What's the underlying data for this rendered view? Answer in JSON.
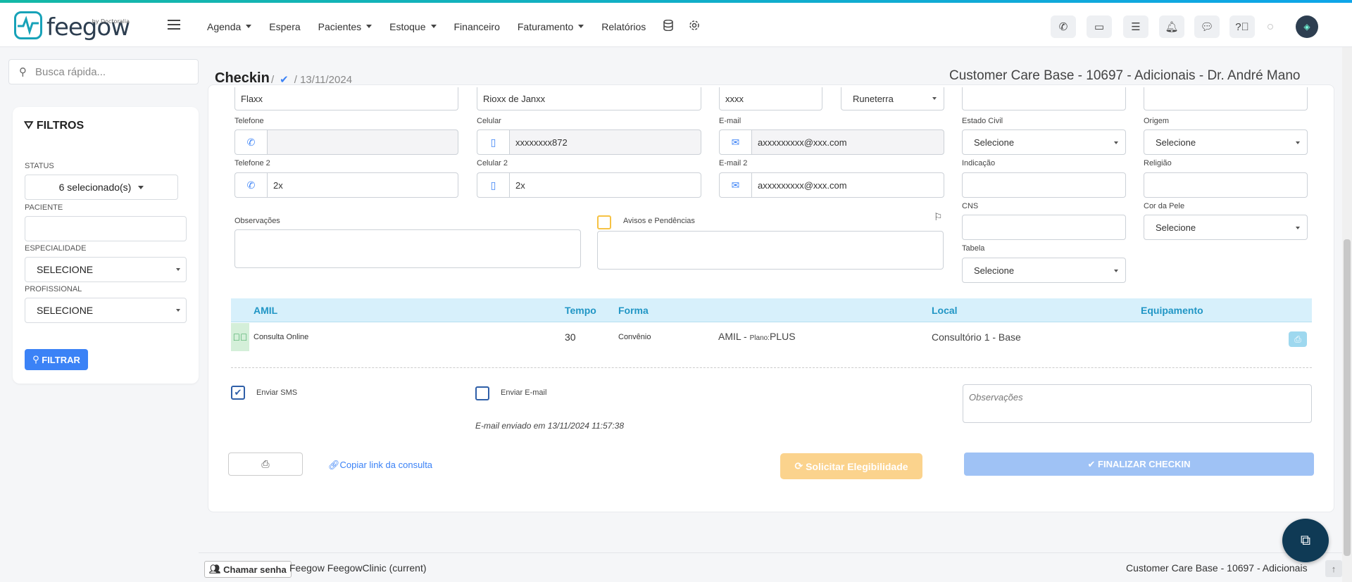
{
  "brand": {
    "name": "feegow",
    "by": "by Doctoralia"
  },
  "nav": [
    {
      "label": "Agenda",
      "caret": true
    },
    {
      "label": "Espera",
      "caret": false
    },
    {
      "label": "Pacientes",
      "caret": true
    },
    {
      "label": "Estoque",
      "caret": true
    },
    {
      "label": "Financeiro",
      "caret": false
    },
    {
      "label": "Faturamento",
      "caret": true
    },
    {
      "label": "Relatórios",
      "caret": false
    }
  ],
  "search": {
    "placeholder": "Busca rápida..."
  },
  "filters": {
    "title": "FILTROS",
    "status_label": "STATUS",
    "status_value": "6 selecionado(s)",
    "paciente_label": "PACIENTE",
    "paciente_value": "",
    "especialidade_label": "ESPECIALIDADE",
    "especialidade_value": "SELECIONE",
    "profissional_label": "PROFISSIONAL",
    "profissional_value": "SELECIONE",
    "button": "FILTRAR"
  },
  "header": {
    "title": "Checkin",
    "separator": "/",
    "date": "13/11/2024",
    "unit": "Customer Care Base - 10697 - Adicionais - Dr. André Mano"
  },
  "form": {
    "row0": {
      "field1": "Flaxx",
      "field2": "Rioxx de Janxx",
      "field3": "xxxx",
      "field4": "Runeterra"
    },
    "telefone_label": "Telefone",
    "telefone_value": "",
    "celular_label": "Celular",
    "celular_value": "xxxxxxxx872",
    "email_label": "E-mail",
    "email_value": "axxxxxxxxx@xxx.com",
    "estado_civil_label": "Estado Civil",
    "estado_civil_value": "Selecione",
    "origem_label": "Origem",
    "origem_value": "Selecione",
    "telefone2_label": "Telefone 2",
    "telefone2_value": "2x",
    "celular2_label": "Celular 2",
    "celular2_value": "2x",
    "email2_label": "E-mail 2",
    "email2_value": "axxxxxxxxx@xxx.com",
    "indicacao_label": "Indicação",
    "indicacao_value": "",
    "religiao_label": "Religião",
    "religiao_value": "",
    "observacoes_label": "Observações",
    "avisos_label": "Avisos e Pendências",
    "cns_label": "CNS",
    "cns_value": "",
    "cor_pele_label": "Cor da Pele",
    "cor_pele_value": "Selecione",
    "tabela_label": "Tabela",
    "tabela_value": "Selecione"
  },
  "procedures": {
    "headers": {
      "name": "AMIL",
      "tempo": "Tempo",
      "forma": "Forma",
      "local": "Local",
      "equipamento": "Equipamento"
    },
    "row": {
      "name": "Consulta Online",
      "tempo": "30",
      "forma": "Convênio",
      "plano_prefix": "AMIL - ",
      "plano_label": "Plano:",
      "plano_value": "PLUS",
      "local": "Consultório 1 - Base"
    }
  },
  "send": {
    "sms_label": "Enviar SMS",
    "sms_checked": true,
    "email_label": "Enviar E-mail",
    "email_checked": false,
    "email_sent_note": "E-mail enviado em 13/11/2024 11:57:38",
    "obs_placeholder": "Observações"
  },
  "actions": {
    "copy_link": "Copiar link da consulta",
    "elegibilidade": "Solicitar Elegibilidade",
    "finalizar": "FINALIZAR CHECKIN"
  },
  "footer": {
    "chamar": "Chamar senha",
    "clinic": "Feegow FeegowClinic (current)",
    "unit": "Customer Care Base - 10697 - Adicionais"
  },
  "colors": {
    "accent": "#3b82f6",
    "teal": "#17a2b8",
    "table_head": "#d7f0fb",
    "warning": "#fbd38d"
  }
}
